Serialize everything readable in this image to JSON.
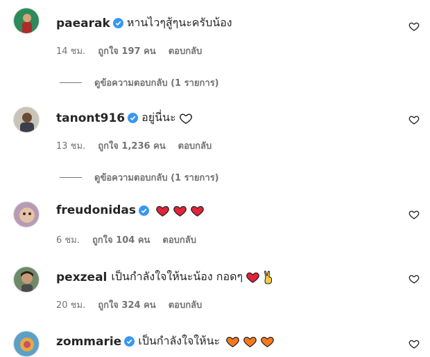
{
  "comments": [
    {
      "username": "paearak",
      "text": "หานไวๆสู้ๆนะครับน้อง",
      "emojis": [],
      "time": "14 ชม.",
      "likes": "ถูกใจ 197 คน",
      "reply": "ตอบกลับ",
      "view_replies": "ดูข้อความตอบกลับ (1 รายการ)"
    },
    {
      "username": "tanont916",
      "text": "อยู่นี่นะ",
      "emojis": [
        "white-heart"
      ],
      "time": "13 ชม.",
      "likes": "ถูกใจ 1,236 คน",
      "reply": "ตอบกลับ",
      "view_replies": "ดูข้อความตอบกลับ (1 รายการ)"
    },
    {
      "username": "freudonidas",
      "text": "",
      "emojis": [
        "red-heart",
        "red-heart",
        "red-heart"
      ],
      "time": "6 ชม.",
      "likes": "ถูกใจ 104 คน",
      "reply": "ตอบกลับ"
    },
    {
      "username": "pexzeal",
      "text": "เป็นกำลังใจให้นะน้อง กอดๆ",
      "emojis": [
        "red-heart",
        "victory-hand"
      ],
      "time": "20 ชม.",
      "likes": "ถูกใจ 324 คน",
      "reply": "ตอบกลับ"
    },
    {
      "username": "zommarie",
      "text": "เป็นกำลังใจให้นะ",
      "emojis": [
        "orange-heart",
        "orange-heart",
        "orange-heart"
      ]
    }
  ],
  "colors": {
    "verified": "#3897f0",
    "red_heart": "#e0243a",
    "orange_heart": "#f4791f",
    "secondary_text": "#737373"
  }
}
